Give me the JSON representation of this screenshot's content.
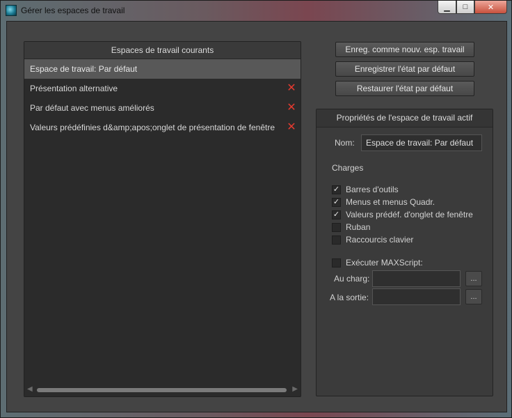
{
  "window": {
    "title": "Gérer les espaces de travail",
    "minimize_glyph": "▁",
    "maximize_glyph": "□",
    "close_glyph": "✕"
  },
  "list": {
    "header": "Espaces de travail courants",
    "items": [
      {
        "label": "Espace de travail: Par défaut",
        "deletable": false,
        "selected": true
      },
      {
        "label": "Présentation alternative",
        "deletable": true
      },
      {
        "label": "Par défaut avec menus améliorés",
        "deletable": true
      },
      {
        "label": "Valeurs prédéfinies d&amp;apos;onglet de présentation de fenêtre",
        "deletable": true
      }
    ],
    "delete_glyph": "✕",
    "scroll_left": "◀",
    "scroll_right": "▶"
  },
  "actions": {
    "save_new": "Enreg. comme nouv. esp. travail",
    "save_default": "Enregistrer l'état par défaut",
    "restore_default": "Restaurer l'état par défaut"
  },
  "properties": {
    "header": "Propriétés de l'espace de travail actif",
    "name_label": "Nom:",
    "name_value": "Espace de travail: Par défaut",
    "charges_label": "Charges",
    "checkboxes": [
      {
        "label": "Barres d'outils",
        "checked": true
      },
      {
        "label": "Menus et menus Quadr.",
        "checked": true
      },
      {
        "label": "Valeurs prédéf. d'onglet de fenêtre",
        "checked": true
      },
      {
        "label": "Ruban",
        "checked": false
      },
      {
        "label": "Raccourcis clavier",
        "checked": false
      }
    ],
    "maxscript": {
      "label": "Exécuter MAXScript:",
      "checked": false
    },
    "on_load_label": "Au charg:",
    "on_exit_label": "A la sortie:",
    "browse_label": "..."
  },
  "check_glyph": "✓"
}
